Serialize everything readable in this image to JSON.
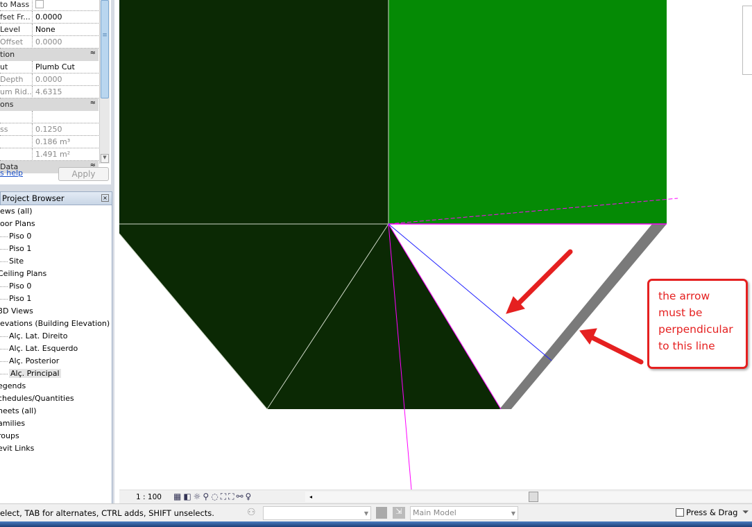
{
  "properties": {
    "rows": [
      {
        "key": "to Mass",
        "value": "",
        "type": "checkbox"
      },
      {
        "key": "fset Fr...",
        "value": "0.0000"
      },
      {
        "key": "Level",
        "value": "None"
      },
      {
        "key": "Offset",
        "value": "0.0000",
        "dim": true
      },
      {
        "key": "tion",
        "section": true
      },
      {
        "key": "ut",
        "value": "Plumb Cut"
      },
      {
        "key": "Depth",
        "value": "0.0000",
        "dim": true
      },
      {
        "key": "um Rid...",
        "value": "4.6315",
        "dim": true
      },
      {
        "key": "ons",
        "section": true
      },
      {
        "key": "",
        "value": ""
      },
      {
        "key": "ss",
        "value": "0.1250",
        "dim": true
      },
      {
        "key": "",
        "value": "0.186 m³",
        "dim": true
      },
      {
        "key": "",
        "value": "1.491 m²",
        "dim": true
      },
      {
        "key": "Data",
        "section": true
      }
    ],
    "help_link": "s help",
    "apply_label": "Apply",
    "collapse_glyph": "≈"
  },
  "project_browser": {
    "title": "Project Browser",
    "items": [
      {
        "label": "iews (all)",
        "level": 0
      },
      {
        "label": "loor Plans",
        "level": 0
      },
      {
        "label": "Piso 0",
        "level": 1
      },
      {
        "label": "Piso 1",
        "level": 1
      },
      {
        "label": "Site",
        "level": 1
      },
      {
        "label": "Ceiling Plans",
        "level": 0
      },
      {
        "label": "Piso 0",
        "level": 1
      },
      {
        "label": "Piso 1",
        "level": 1
      },
      {
        "label": "3D Views",
        "level": 0
      },
      {
        "label": "levations (Building Elevation)",
        "level": 0
      },
      {
        "label": "Alç. Lat. Direito",
        "level": 1
      },
      {
        "label": "Alç. Lat. Esquerdo",
        "level": 1
      },
      {
        "label": "Alç. Posterior",
        "level": 1
      },
      {
        "label": "Alç. Principal",
        "level": 1,
        "selected": true
      },
      {
        "label": "egends",
        "level": 0
      },
      {
        "label": "chedules/Quantities",
        "level": 0
      },
      {
        "label": "heets (all)",
        "level": 0
      },
      {
        "label": "amilies",
        "level": 0
      },
      {
        "label": "roups",
        "level": 0
      },
      {
        "label": "evit Links",
        "level": 0
      }
    ]
  },
  "view_bar": {
    "scale": "1 : 100"
  },
  "status_bar": {
    "text": "elect, TAB for alternates, CTRL adds, SHIFT unselects.",
    "workset_value": "",
    "model_value": "Main Model",
    "press_drag_label": "Press & Drag",
    "press_drag_checked": false
  },
  "annotation": {
    "callout_lines": [
      "the arrow",
      "must be",
      "perpendicular",
      "to this line"
    ]
  },
  "colors": {
    "dark_green": "#0b2904",
    "green": "#058a05",
    "gray_band": "#7a7a7a",
    "magenta": "#ff00ff",
    "blue": "#2020ff",
    "annotation_red": "#e52020"
  }
}
